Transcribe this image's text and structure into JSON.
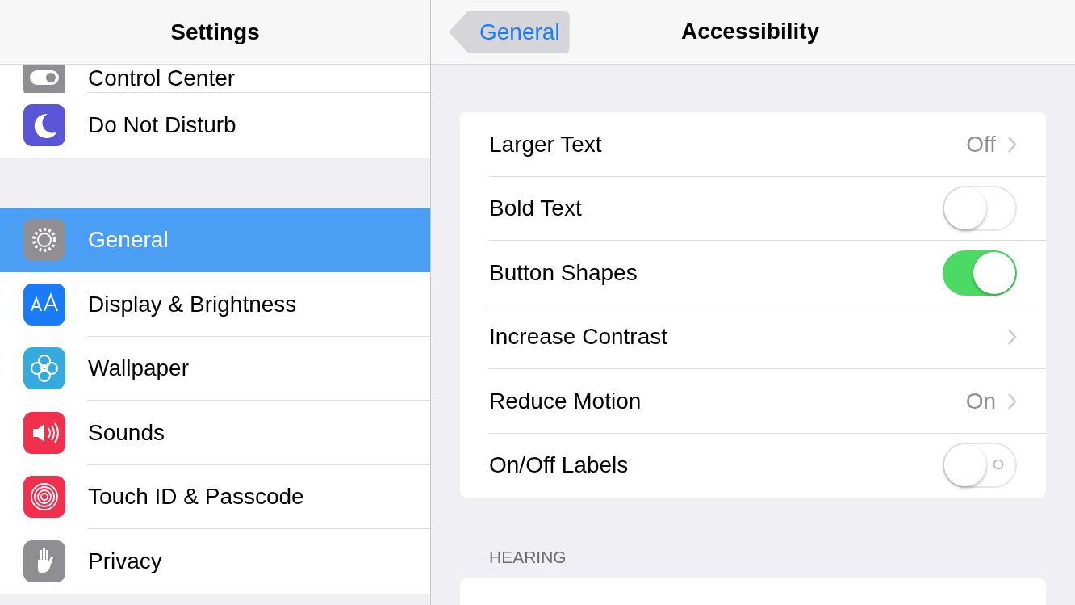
{
  "sidebar": {
    "title": "Settings",
    "items": [
      {
        "label": "Control Center",
        "selected": false
      },
      {
        "label": "Do Not Disturb",
        "selected": false
      },
      {
        "label": "General",
        "selected": true
      },
      {
        "label": "Display & Brightness",
        "selected": false
      },
      {
        "label": "Wallpaper",
        "selected": false
      },
      {
        "label": "Sounds",
        "selected": false
      },
      {
        "label": "Touch ID & Passcode",
        "selected": false
      },
      {
        "label": "Privacy",
        "selected": false
      }
    ]
  },
  "detail": {
    "back": "General",
    "title": "Accessibility",
    "rows": [
      {
        "kind": "link",
        "label": "Larger Text",
        "value": "Off"
      },
      {
        "kind": "toggle",
        "label": "Bold Text",
        "on": false
      },
      {
        "kind": "toggle",
        "label": "Button Shapes",
        "on": true
      },
      {
        "kind": "link",
        "label": "Increase Contrast"
      },
      {
        "kind": "link",
        "label": "Reduce Motion",
        "value": "On"
      },
      {
        "kind": "toggle",
        "label": "On/Off Labels",
        "on": false,
        "label_mark": true
      }
    ],
    "section_header": "HEARING"
  }
}
